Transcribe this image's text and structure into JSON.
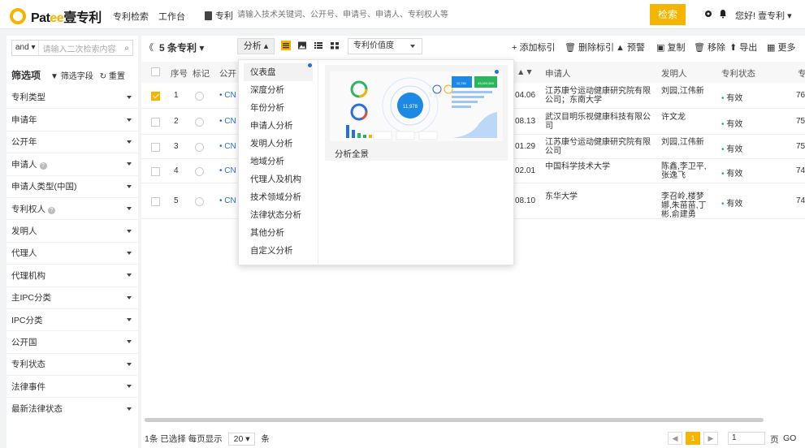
{
  "app": {
    "logo_part1": "Pat",
    "logo_part2": "ee",
    "logo_part3": "壹专利",
    "nav": [
      "专利检索",
      "工作台"
    ],
    "search_type": "专利",
    "search_placeholder": "请输入技术关键词、公开号、申请号、申请人、专利权人等",
    "search_button": "检索",
    "greeting": "您好! 壹专利 ▾"
  },
  "sidebar": {
    "and_label": "and ▾",
    "secondary_placeholder": "请输入二次检索内容",
    "filter_title": "筛选项",
    "filter_field_btn": "▼ 筛选字段",
    "reset_btn": "↻ 重置",
    "items": [
      {
        "label": "专利类型",
        "help": false
      },
      {
        "label": "申请年",
        "help": false
      },
      {
        "label": "公开年",
        "help": false
      },
      {
        "label": "申请人",
        "help": true
      },
      {
        "label": "申请人类型(中国)",
        "help": false
      },
      {
        "label": "专利权人",
        "help": true
      },
      {
        "label": "发明人",
        "help": false
      },
      {
        "label": "代理人",
        "help": false
      },
      {
        "label": "代理机构",
        "help": false
      },
      {
        "label": "主IPC分类",
        "help": false
      },
      {
        "label": "IPC分类",
        "help": false
      },
      {
        "label": "公开国",
        "help": false
      },
      {
        "label": "专利状态",
        "help": false
      },
      {
        "label": "法律事件",
        "help": false
      },
      {
        "label": "最新法律状态",
        "help": false
      }
    ]
  },
  "toolbar": {
    "collapse": "《",
    "count": "5 条专利 ▾",
    "analysis": "分析 ▴",
    "value_select": "专利价值度",
    "add_tag": "+ 添加标引",
    "delete_tag": "🗑 删除标引",
    "alert": "▲ 预警",
    "copy": "复制",
    "remove": "移除",
    "export": "⬆ 导出",
    "more": "更多"
  },
  "table": {
    "headers": [
      "序号",
      "标记",
      "公开",
      "申请人",
      "发明人",
      "专利状态",
      "专"
    ],
    "rows": [
      {
        "num": "1",
        "pub": "• CN",
        "date": "04.06",
        "applicant": "江苏康兮运动健康研究院有限公司；东南大学",
        "inventor": "刘园,江伟新",
        "status": "有效",
        "score": "76",
        "checked": true
      },
      {
        "num": "2",
        "pub": "• CN",
        "date": "08.13",
        "applicant": "武汉目明乐视健康科技有限公司",
        "inventor": "许文龙",
        "status": "有效",
        "score": "75",
        "checked": false
      },
      {
        "num": "3",
        "pub": "• CN",
        "date": "01.29",
        "applicant": "江苏康兮运动健康研究院有限公司",
        "inventor": "刘园,江伟新",
        "status": "有效",
        "score": "75",
        "checked": false
      },
      {
        "num": "4",
        "pub": "• CN",
        "date": "02.01",
        "applicant": "中国科学技术大学",
        "inventor": "陈鑫,李卫平,张逸飞",
        "status": "有效",
        "score": "74",
        "checked": false
      },
      {
        "num": "5",
        "pub": "• CN",
        "date": "08.10",
        "applicant": "东华大学",
        "inventor": "李召岭,楼梦娜,朱苗苗,丁彬,俞建勇",
        "status": "有效",
        "score": "74",
        "checked": false
      }
    ]
  },
  "footer": {
    "selected": "1条 已选择 每页显示",
    "page_size": "20 ▾",
    "unit": "条",
    "prev": "◀",
    "current_page": "1",
    "next": "▶",
    "goto_value": "1",
    "page_label": "页",
    "go": "GO"
  },
  "analysis_menu": {
    "items": [
      "仪表盘",
      "深度分析",
      "年份分析",
      "申请人分析",
      "发明人分析",
      "地域分析",
      "代理人及机构",
      "技术领域分析",
      "法律状态分析",
      "其他分析",
      "自定义分析"
    ],
    "card_caption": "分析全景",
    "card_center_value": "11,978",
    "card_stat_1": "12,781",
    "card_stat_2": "43,003,500"
  },
  "colors": {
    "accent": "#f5b400",
    "link": "#2a6fd6",
    "valid": "#2db55d"
  }
}
